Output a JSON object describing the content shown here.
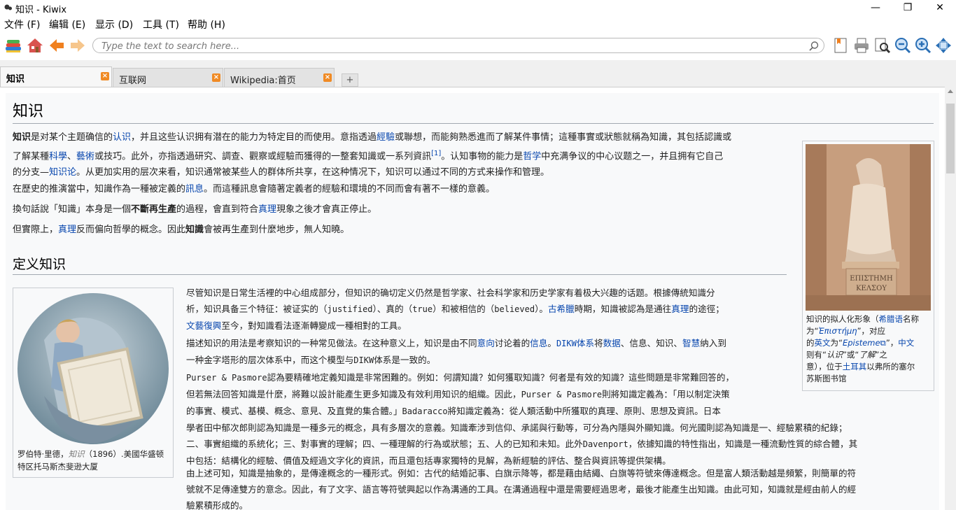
{
  "window": {
    "title": "知识 - Kiwix",
    "minimize": "—",
    "maximize": "❐",
    "close": "✕"
  },
  "menu": [
    "文件 (F)",
    "编辑 (E)",
    "显示 (D)",
    "工具 (T)",
    "帮助 (H)"
  ],
  "search": {
    "placeholder": "Type the text to search here..."
  },
  "tabs": [
    {
      "label": "知识",
      "active": true
    },
    {
      "label": "互联网",
      "active": false
    },
    {
      "label": "Wikipedia:首页",
      "active": false
    }
  ],
  "new_tab": "+",
  "article": {
    "title": "知识",
    "intro": {
      "l1": [
        {
          "t": "知识",
          "b": true
        },
        {
          "t": "是对某个主题确信的"
        },
        {
          "t": "认识",
          "link": true
        },
        {
          "t": "，并且这些认识拥有潜在的能力为特定目的而使用。意指透過"
        },
        {
          "t": "經驗",
          "link": true
        },
        {
          "t": "或聯想，而能夠熟悉進而了解某件事情；這種事實或狀態就稱為知識，其包括認識或"
        }
      ],
      "l2": [
        {
          "t": "了解某種"
        },
        {
          "t": "科學",
          "link": true
        },
        {
          "t": "、"
        },
        {
          "t": "藝術",
          "link": true
        },
        {
          "t": "或技巧。此外，亦指透過研究、調查、觀察或經驗而獲得的一整套知識或一系列資訊"
        },
        {
          "t": "[1]",
          "link": true,
          "sup": true
        },
        {
          "t": "。认知事物的能力是"
        },
        {
          "t": "哲学",
          "link": true
        },
        {
          "t": "中充满争议的中心议题之一，并且拥有它自己"
        }
      ],
      "l3": [
        {
          "t": "的分支—"
        },
        {
          "t": "知识论",
          "link": true
        },
        {
          "t": "。从更加实用的层次来看，知识通常被某些人的群体所共享，在这种情况下，知识可以通过不同的方式来操作和管理。"
        }
      ]
    },
    "p2": [
      {
        "t": "在歷史的推演當中，知識作為一種被定義的"
      },
      {
        "t": "訊息",
        "link": true
      },
      {
        "t": "。而這種訊息會隨著定義者的經驗和環境的不同而會有著不一樣的意義。"
      }
    ],
    "p3": [
      {
        "t": "換句話說「知識」本身是一個"
      },
      {
        "t": "不斷再生產",
        "b": true
      },
      {
        "t": "的過程，會直到符合"
      },
      {
        "t": "真理",
        "link": true
      },
      {
        "t": "現象之後才會真正停止。"
      }
    ],
    "p4": [
      {
        "t": "但實際上，"
      },
      {
        "t": "真理",
        "link": true
      },
      {
        "t": "反而偏向哲學的概念。因此"
      },
      {
        "t": "知識",
        "b": true
      },
      {
        "t": "會被再生產到什麼地步，無人知曉。"
      }
    ],
    "h2": "定义知识",
    "def": {
      "d1": [
        [
          {
            "t": "尽管知识是日常生活裡的中心组成部分，但知识的确切定义仍然是哲学家、社会科学家和历史学家有着极大兴趣的话题。根據傳統知識分"
          }
        ],
        [
          {
            "t": "析，知识具备三个特征：被证实的（"
          },
          {
            "t": "justified",
            "m": true
          },
          {
            "t": "）、真的（"
          },
          {
            "t": "true",
            "m": true
          },
          {
            "t": "）和被相信的（"
          },
          {
            "t": "believed",
            "m": true
          },
          {
            "t": "）。"
          },
          {
            "t": "古希臘",
            "link": true
          },
          {
            "t": "時期，知識被認為是通往"
          },
          {
            "t": "真理",
            "link": true
          },
          {
            "t": "的途徑；"
          }
        ],
        [
          {
            "t": "文藝復興",
            "link": true
          },
          {
            "t": "至今，對知識看法逐漸轉變成一種相對的工具。"
          }
        ]
      ],
      "d2": [
        [
          {
            "t": "描述知识的用法是考察知识的一种常见做法。在这种意义上，知识是由不同"
          },
          {
            "t": "意向",
            "link": true
          },
          {
            "t": "讨论着的"
          },
          {
            "t": "信息",
            "link": true
          },
          {
            "t": "。"
          },
          {
            "t": "DIKW",
            "link": true,
            "m": true
          },
          {
            "t": "体系",
            "link": true
          },
          {
            "t": "将"
          },
          {
            "t": "数据",
            "link": true
          },
          {
            "t": "、信息、知识、"
          },
          {
            "t": "智慧",
            "link": true
          },
          {
            "t": "纳入到"
          }
        ],
        [
          {
            "t": "一种金字塔形的层次体系中，而这个模型与"
          },
          {
            "t": "DIKW",
            "m": true
          },
          {
            "t": "体系是一致的。"
          }
        ]
      ],
      "d3": [
        [
          {
            "t": "Purser & Pasmore",
            "m": true
          },
          {
            "t": "認為要精確地定義知識是非常困難的。例如：何謂知識？如何獲取知識？何者是有效的知識？這些問題是非常難回答的，"
          }
        ],
        [
          {
            "t": "但若無法回答知識是什麼，將難以設計能產生更多知識及有效利用知识的組織。因此，"
          },
          {
            "t": "Purser & Pasmore",
            "m": true
          },
          {
            "t": "則將知識定義為：「用以制定決策"
          }
        ],
        [
          {
            "t": "的事實、模式、基模、概念、意見、及直覺的集合體。」"
          },
          {
            "t": "Badaracco",
            "m": true
          },
          {
            "t": "將知識定義為：從人類活動中所獲取的真理、原則、思想及資訊。日本"
          }
        ],
        [
          {
            "t": "學者田中郁次郎則認為知識是一種多元的概念，具有多層次的意義。知識牽涉到信仰、承諾與行動等，可分為內隱與外顯知識。何光國則認為知識是一、經驗累積的紀錄；"
          }
        ],
        [
          {
            "t": "二、事實組織的系統化；三、對事實的理解；四、一種理解的行為或狀態；五、人的已知和未知。此外"
          },
          {
            "t": "Davenport",
            "m": true
          },
          {
            "t": "，依據知識的特性指出，知識是一種流動性質的綜合體，其"
          }
        ],
        [
          {
            "t": "中包括：結構化的經驗、價值及經過文字化的資訊，而且還包括專家獨特的見解，為新經驗的評估、整合與資訊等提供架構。"
          }
        ]
      ],
      "d4": [
        [
          {
            "t": "由上述可知，知識是抽象的，是傳達概念的一種形式。例如：古代的結婚記事、白旗示降等，都是藉由結繩、白旗等符號來傳達概念。但是富人類活動越是頻繁，則簡單的符"
          }
        ],
        [
          {
            "t": "號就不足傳達雙方的意念。因此，有了文字、語言等符號興起以作為溝通的工具。在溝通過程中還是需要經過思考，最後才能產生出知識。由此可知，知識就是經由前人的經"
          }
        ],
        [
          {
            "t": "驗累積形成的。"
          }
        ]
      ]
    },
    "thumb_right_caption": [
      [
        {
          "t": "知识的拟人化形象（"
        },
        {
          "t": "希腊语",
          "link": true
        },
        {
          "t": "名称"
        }
      ],
      [
        {
          "t": "为“"
        },
        {
          "t": "Ἐπιστήμη",
          "link": true,
          "i": true
        },
        {
          "t": "”，对应"
        }
      ],
      [
        {
          "t": "的"
        },
        {
          "t": "英文",
          "link": true
        },
        {
          "t": "为“"
        },
        {
          "t": "Episteme",
          "link": true,
          "i": true
        },
        {
          "t": "⧉",
          "link": true
        },
        {
          "t": "”，"
        },
        {
          "t": "中文",
          "link": true
        }
      ],
      [
        {
          "t": "则有“"
        },
        {
          "t": "认识",
          "i": true
        },
        {
          "t": "”或“"
        },
        {
          "t": "了解",
          "i": true
        },
        {
          "t": "”之"
        }
      ],
      [
        {
          "t": "意），位于"
        },
        {
          "t": "土耳其",
          "link": true
        },
        {
          "t": "以弗所的塞尔"
        }
      ],
      [
        {
          "t": "苏斯图书馆"
        }
      ]
    ],
    "statue_inscription": [
      "ΕΠΙΣΤΗΜΗ",
      "ΚΕΛΣΟΥ"
    ],
    "thumb_left_caption": [
      [
        {
          "t": "罗伯特·里德，"
        },
        {
          "t": "知识",
          "i": true,
          "gray": true
        },
        {
          "t": "（1896）.美國华盛顿"
        }
      ],
      [
        {
          "t": "特区托马斯杰斐逊大厦"
        }
      ]
    ]
  },
  "colors": {
    "link": "#0645ad",
    "tab_close": "#f08a24",
    "page_bg": "#f8f9fa"
  }
}
